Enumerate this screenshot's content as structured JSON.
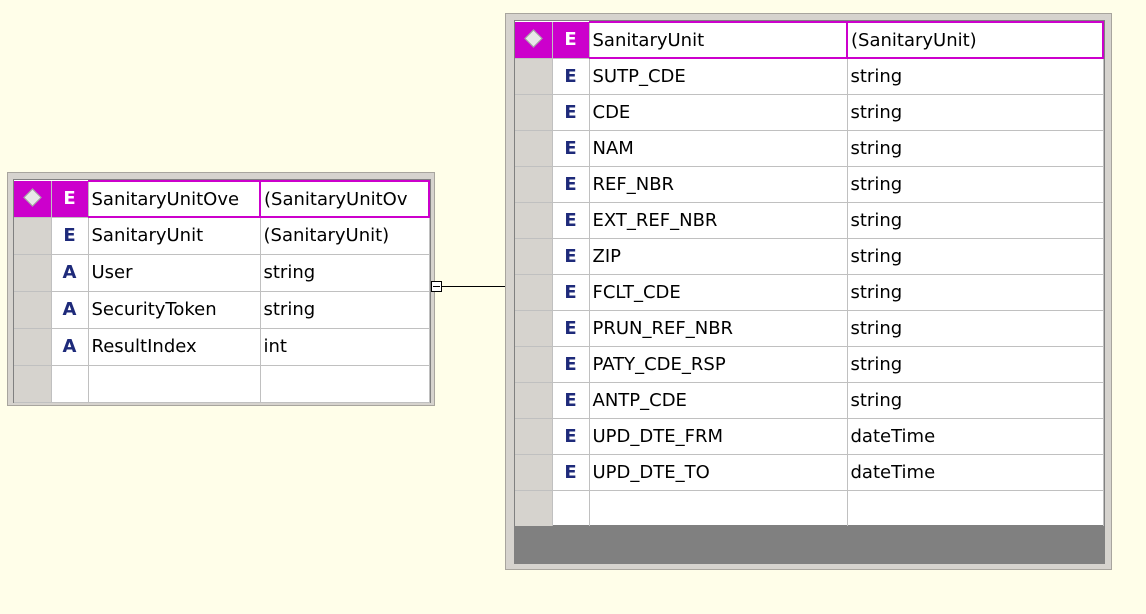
{
  "colors": {
    "background": "#FFFEE9",
    "header": "#CC00CC",
    "kind_letter": "#1E2A7A"
  },
  "icons": {
    "header_diamond": "diamond-icon",
    "collapse": "collapse-box-icon"
  },
  "left_entity": {
    "header": {
      "kind": "E",
      "name": "SanitaryUnitOve",
      "type": "(SanitaryUnitOv"
    },
    "rows": [
      {
        "kind": "E",
        "name": "SanitaryUnit",
        "type": "(SanitaryUnit)"
      },
      {
        "kind": "A",
        "name": "User",
        "type": "string"
      },
      {
        "kind": "A",
        "name": "SecurityToken",
        "type": "string"
      },
      {
        "kind": "A",
        "name": "ResultIndex",
        "type": "int"
      },
      {
        "kind": "",
        "name": "",
        "type": ""
      }
    ]
  },
  "right_entity": {
    "header": {
      "kind": "E",
      "name": "SanitaryUnit",
      "type": "(SanitaryUnit)"
    },
    "rows": [
      {
        "kind": "E",
        "name": "SUTP_CDE",
        "type": "string"
      },
      {
        "kind": "E",
        "name": "CDE",
        "type": "string"
      },
      {
        "kind": "E",
        "name": "NAM",
        "type": "string"
      },
      {
        "kind": "E",
        "name": "REF_NBR",
        "type": "string"
      },
      {
        "kind": "E",
        "name": "EXT_REF_NBR",
        "type": "string"
      },
      {
        "kind": "E",
        "name": "ZIP",
        "type": "string"
      },
      {
        "kind": "E",
        "name": "FCLT_CDE",
        "type": "string"
      },
      {
        "kind": "E",
        "name": "PRUN_REF_NBR",
        "type": "string"
      },
      {
        "kind": "E",
        "name": "PATY_CDE_RSP",
        "type": "string"
      },
      {
        "kind": "E",
        "name": "ANTP_CDE",
        "type": "string"
      },
      {
        "kind": "E",
        "name": "UPD_DTE_FRM",
        "type": "dateTime"
      },
      {
        "kind": "E",
        "name": "UPD_DTE_TO",
        "type": "dateTime"
      },
      {
        "kind": "",
        "name": "",
        "type": ""
      }
    ]
  }
}
